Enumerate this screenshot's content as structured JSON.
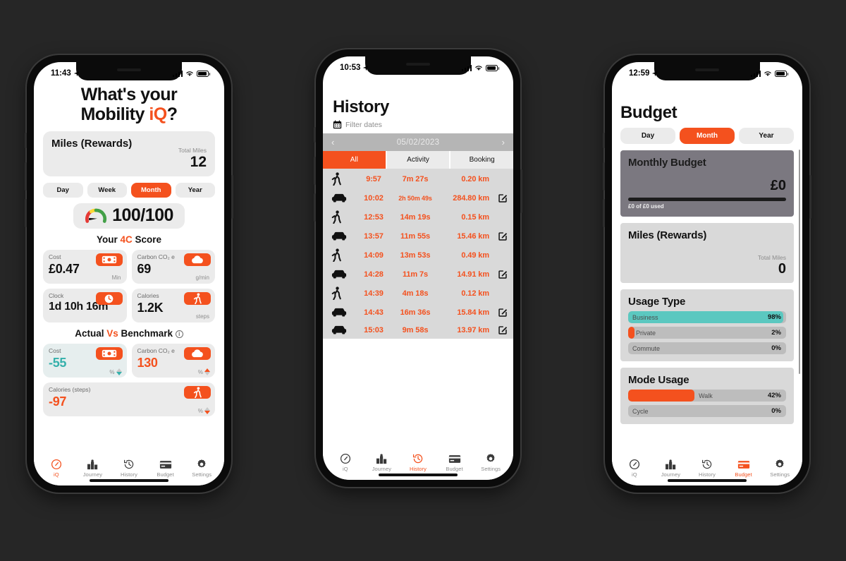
{
  "background_color": "#262626",
  "accent_color": "#F4511E",
  "teal_color": "#35b0ab",
  "phones": {
    "iq": {
      "status": {
        "time": "11:43",
        "location_icon": "location-arrow-icon",
        "signal_icon": "cellular-signal-icon",
        "wifi_icon": "wifi-icon",
        "battery_icon": "battery-icon"
      },
      "hero": {
        "line1": "What's your",
        "line2_a": "Mobility ",
        "line2_b": "iQ",
        "line2_c": "?"
      },
      "miles_card": {
        "title": "Miles (Rewards)",
        "sub_label": "Total Miles",
        "value": "12"
      },
      "period_tabs": [
        {
          "label": "Day",
          "active": false
        },
        {
          "label": "Week",
          "active": false
        },
        {
          "label": "Month",
          "active": true
        },
        {
          "label": "Year",
          "active": false
        }
      ],
      "score": {
        "icon": "gauge-icon",
        "value": "100/100"
      },
      "score_section_title": {
        "pre": "Your ",
        "hl": "4C",
        "post": " Score"
      },
      "score_cards": [
        {
          "label": "Cost",
          "value": "£0.47",
          "unit": "Min",
          "icon": "banknote-icon"
        },
        {
          "label": "Carbon CO₂ e",
          "value": "69",
          "unit": "g/min",
          "icon": "cloud-icon"
        },
        {
          "label": "Clock",
          "value": "1d 10h 16m",
          "unit": "",
          "icon": "clock-icon"
        },
        {
          "label": "Calories",
          "value": "1.2K",
          "unit": "steps",
          "icon": "walking-icon"
        }
      ],
      "benchmark_title": {
        "pre": "Actual ",
        "hl": "Vs",
        "post": " Benchmark"
      },
      "benchmark_info_icon": "info-icon",
      "benchmark_cards": [
        {
          "label": "Cost",
          "value": "-55",
          "unit": "%",
          "icon": "banknote-icon",
          "color": "teal",
          "trend": "down"
        },
        {
          "label": "Carbon CO₂ e",
          "value": "130",
          "unit": "%",
          "icon": "cloud-icon",
          "color": "orange",
          "trend": "up"
        },
        {
          "label": "Calories (steps)",
          "value": "-97",
          "unit": "%",
          "icon": "walking-icon",
          "color": "orange",
          "trend": "down-red"
        }
      ],
      "tabs": [
        {
          "label": "iQ",
          "icon": "gauge-icon",
          "active": true
        },
        {
          "label": "Journey",
          "icon": "journey-icon",
          "active": false
        },
        {
          "label": "History",
          "icon": "history-clock-icon",
          "active": false
        },
        {
          "label": "Budget",
          "icon": "card-icon",
          "active": false
        },
        {
          "label": "Settings",
          "icon": "gear-icon",
          "active": false
        }
      ]
    },
    "history": {
      "status": {
        "time": "10:53",
        "location_icon": "location-arrow-icon",
        "signal_icon": "cellular-signal-icon",
        "wifi_icon": "wifi-icon",
        "battery_icon": "battery-icon"
      },
      "title": "History",
      "filter": {
        "icon": "calendar-icon",
        "label": "Filter dates"
      },
      "date_nav": {
        "prev_icon": "chevron-left-icon",
        "date": "05/02/2023",
        "next_icon": "chevron-right-icon"
      },
      "tabs": [
        {
          "label": "All",
          "active": true
        },
        {
          "label": "Activity",
          "active": false
        },
        {
          "label": "Booking",
          "active": false
        }
      ],
      "columns": [
        "mode",
        "time",
        "duration",
        "distance",
        "edit"
      ],
      "rows": [
        {
          "mode": "walk-icon",
          "time": "9:57",
          "duration": "7m 27s",
          "distance": "0.20 km",
          "edit": false
        },
        {
          "mode": "car-icon",
          "time": "10:02",
          "duration": "2h 50m 49s",
          "distance": "284.80 km",
          "edit": true
        },
        {
          "mode": "walk-icon",
          "time": "12:53",
          "duration": "14m 19s",
          "distance": "0.15 km",
          "edit": false
        },
        {
          "mode": "car-icon",
          "time": "13:57",
          "duration": "11m 55s",
          "distance": "15.46 km",
          "edit": true
        },
        {
          "mode": "walk-icon",
          "time": "14:09",
          "duration": "13m 53s",
          "distance": "0.49 km",
          "edit": false
        },
        {
          "mode": "car-icon",
          "time": "14:28",
          "duration": "11m 7s",
          "distance": "14.91 km",
          "edit": true
        },
        {
          "mode": "walk-icon",
          "time": "14:39",
          "duration": "4m 18s",
          "distance": "0.12 km",
          "edit": false
        },
        {
          "mode": "car-icon",
          "time": "14:43",
          "duration": "16m 36s",
          "distance": "15.84 km",
          "edit": true
        },
        {
          "mode": "car-icon",
          "time": "15:03",
          "duration": "9m 58s",
          "distance": "13.97 km",
          "edit": true
        }
      ],
      "tabbar": [
        {
          "label": "iQ",
          "icon": "gauge-icon",
          "active": false
        },
        {
          "label": "Journey",
          "icon": "journey-icon",
          "active": false
        },
        {
          "label": "History",
          "icon": "history-clock-icon",
          "active": true
        },
        {
          "label": "Budget",
          "icon": "card-icon",
          "active": false
        },
        {
          "label": "Settings",
          "icon": "gear-icon",
          "active": false
        }
      ]
    },
    "budget": {
      "status": {
        "time": "12:59",
        "location_icon": "location-arrow-icon",
        "signal_icon": "cellular-signal-icon",
        "wifi_icon": "wifi-icon",
        "battery_icon": "battery-icon"
      },
      "title": "Budget",
      "period_tabs": [
        {
          "label": "Day",
          "active": false
        },
        {
          "label": "Month",
          "active": true
        },
        {
          "label": "Year",
          "active": false
        }
      ],
      "monthly_budget": {
        "title": "Monthly Budget",
        "amount": "£0",
        "used_text": "£0 of £0 used",
        "progress_pct": 100
      },
      "miles_card": {
        "title": "Miles (Rewards)",
        "sub_label": "Total Miles",
        "value": "0"
      },
      "usage_type": {
        "title": "Usage Type",
        "bars": [
          {
            "label": "Business",
            "pct": "98%",
            "fill": 98,
            "color": "#5bc8c0"
          },
          {
            "label": "Private",
            "pct": "2%",
            "fill": 4,
            "color": "#F4511E"
          },
          {
            "label": "Commute",
            "pct": "0%",
            "fill": 0,
            "color": "#F4511E"
          }
        ]
      },
      "mode_usage": {
        "title": "Mode Usage",
        "bars": [
          {
            "label": "Walk",
            "pct": "42%",
            "fill": 42,
            "color": "#F4511E"
          },
          {
            "label": "Cycle",
            "pct": "0%",
            "fill": 0,
            "color": "#F4511E"
          }
        ]
      },
      "tabbar": [
        {
          "label": "iQ",
          "icon": "gauge-icon",
          "active": false
        },
        {
          "label": "Journey",
          "icon": "journey-icon",
          "active": false
        },
        {
          "label": "History",
          "icon": "history-clock-icon",
          "active": false
        },
        {
          "label": "Budget",
          "icon": "card-icon",
          "active": true
        },
        {
          "label": "Settings",
          "icon": "gear-icon",
          "active": false
        }
      ]
    }
  }
}
